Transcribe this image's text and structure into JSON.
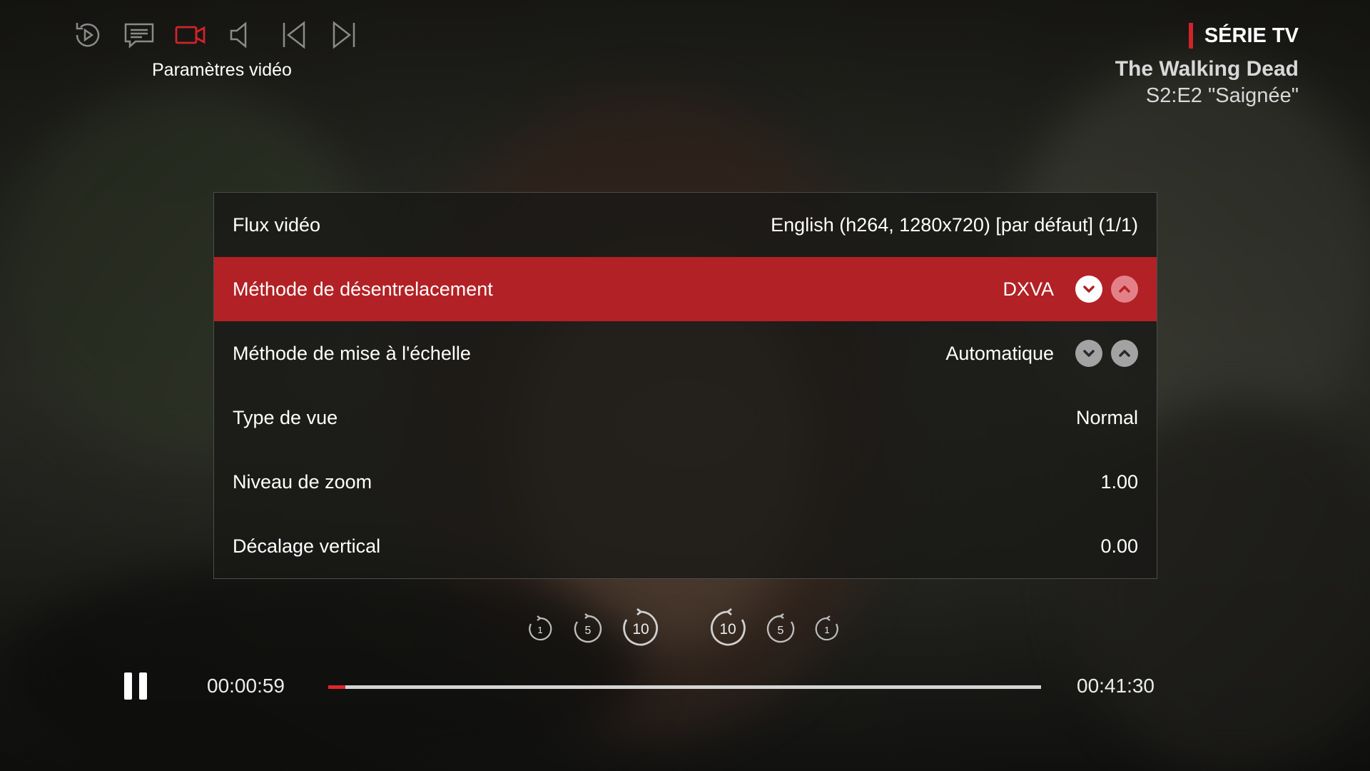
{
  "toolbar": {
    "icons": [
      "replay-icon",
      "subtitles-icon",
      "video-settings-icon",
      "audio-icon",
      "previous-icon",
      "next-icon"
    ],
    "active_label": "Paramètres vidéo"
  },
  "media": {
    "category": "SÉRIE TV",
    "show_title": "The Walking Dead",
    "episode": "S2:E2 \"Saignée\""
  },
  "settings": {
    "rows": [
      {
        "label": "Flux vidéo",
        "value": "English (h264, 1280x720) [par défaut] (1/1)"
      },
      {
        "label": "Méthode de désentrelacement",
        "value": "DXVA"
      },
      {
        "label": "Méthode de mise à l'échelle",
        "value": "Automatique"
      },
      {
        "label": "Type de vue",
        "value": "Normal"
      },
      {
        "label": "Niveau de zoom",
        "value": "1.00"
      },
      {
        "label": "Décalage vertical",
        "value": "0.00"
      }
    ]
  },
  "skip_controls": {
    "back": [
      "1",
      "5",
      "10"
    ],
    "forward": [
      "10",
      "5",
      "1"
    ]
  },
  "playback": {
    "current_time": "00:00:59",
    "total_time": "00:41:30",
    "progress_fraction": 0.024
  },
  "colors": {
    "accent": "#d0242a",
    "highlight_row": "#b22125",
    "arrow_up_active": "#e48088",
    "arrow_inactive": "#a3a3a3"
  }
}
